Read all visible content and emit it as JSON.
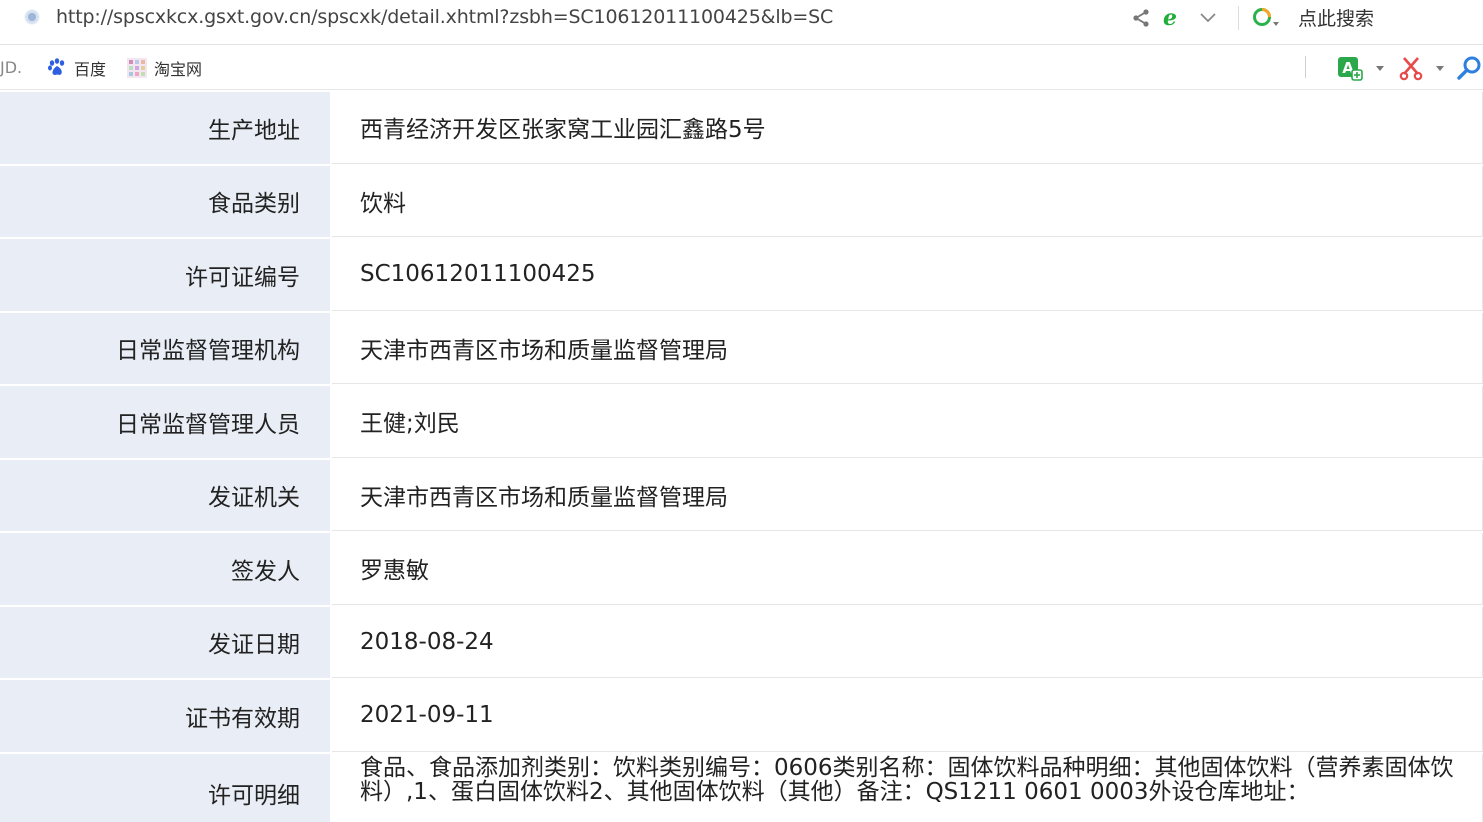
{
  "browser": {
    "url": "http://spscxkcx.gsxt.gov.cn/spscxk/detail.xhtml?zsbh=SC10612011100425&lb=SC",
    "search_placeholder": "点此搜索"
  },
  "bookmarks": {
    "partial_item": "JD.",
    "items": [
      {
        "label": "百度",
        "icon": "baidu-paw-icon"
      },
      {
        "label": "淘宝网",
        "icon": "taobao-icon"
      }
    ]
  },
  "colors": {
    "label_bg": "#e9eef6",
    "accent_green": "#1fae3a",
    "scissors_red": "#e84a4a",
    "search_blue": "#2f7fe0"
  },
  "details": [
    {
      "label": "生产地址",
      "value": "西青经济开发区张家窝工业园汇鑫路5号"
    },
    {
      "label": "食品类别",
      "value": "饮料"
    },
    {
      "label": "许可证编号",
      "value": "SC10612011100425"
    },
    {
      "label": "日常监督管理机构",
      "value": "天津市西青区市场和质量监督管理局"
    },
    {
      "label": "日常监督管理人员",
      "value": "王健;刘民"
    },
    {
      "label": "发证机关",
      "value": "天津市西青区市场和质量监督管理局"
    },
    {
      "label": "签发人",
      "value": "罗惠敏"
    },
    {
      "label": "发证日期",
      "value": "2018-08-24"
    },
    {
      "label": "证书有效期",
      "value": "2021-09-11"
    },
    {
      "label": "许可明细",
      "value": "食品、食品添加剂类别：饮料类别编号：0606类别名称：固体饮料品种明细：其他固体饮料（营养素固体饮料）,1、蛋白固体饮料2、其他固体饮料（其他）备注：QS1211 0601 0003外设仓库地址："
    }
  ]
}
